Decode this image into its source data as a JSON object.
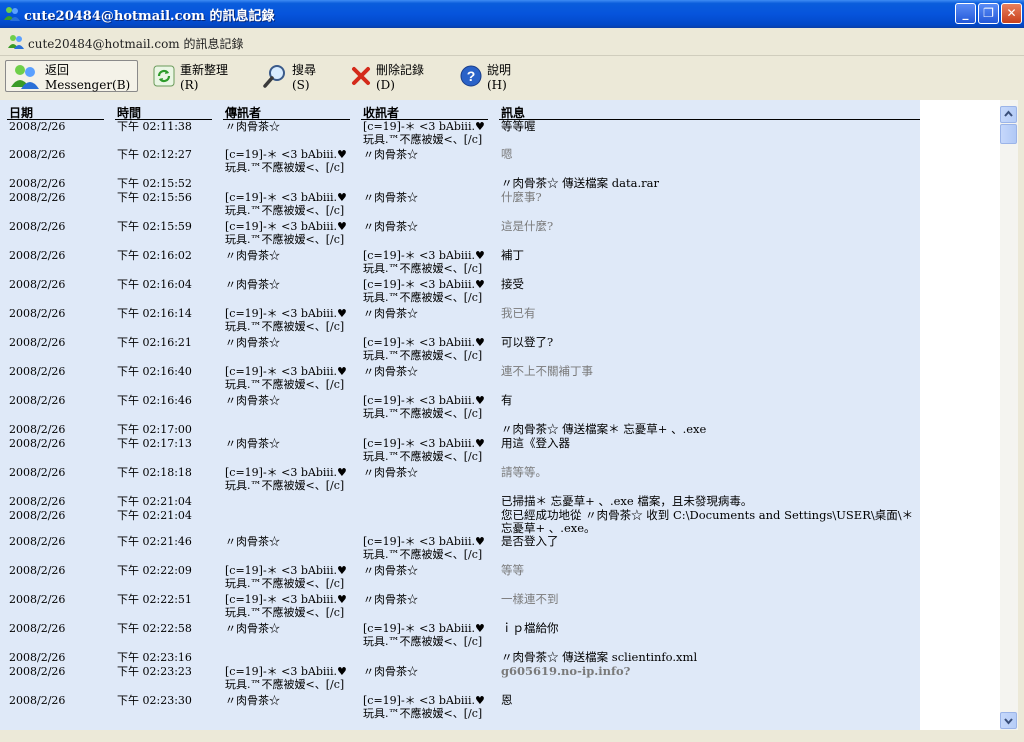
{
  "window": {
    "title": "cute20484@hotmail.com 的訊息記錄",
    "minimize": "_",
    "maximize": "❐",
    "close": "✕"
  },
  "header": {
    "title": "cute20484@hotmail.com 的訊息記錄"
  },
  "toolbar": {
    "back": "返回 Messenger(B)",
    "refresh": "重新整理(R)",
    "search": "搜尋(S)",
    "delete": "刪除記錄(D)",
    "help": "說明(H)"
  },
  "columns": {
    "date": "日期",
    "time": "時間",
    "sender": "傳訊者",
    "receiver": "收訊者",
    "message": "訊息"
  },
  "rows": [
    {
      "date": "2008/2/26",
      "time": "下午 02:11:38",
      "sender": "〃肉骨茶☆",
      "receiver": "[c=19]-＊ <3 bAbiii.♥玩具.™不應被嫒<、[/c]",
      "message": "等等喔",
      "style": "normal"
    },
    {
      "date": "2008/2/26",
      "time": "下午 02:12:27",
      "sender": "[c=19]-＊ <3 bAbiii.♥玩具.™不應被嫒<、[/c]",
      "receiver": "〃肉骨茶☆",
      "message": "嗯",
      "style": "grey"
    },
    {
      "date": "2008/2/26",
      "time": "下午 02:15:52",
      "sender": "",
      "receiver": "",
      "message": "〃肉骨茶☆ 傳送檔案 data.rar",
      "style": "normal"
    },
    {
      "date": "2008/2/26",
      "time": "下午 02:15:56",
      "sender": "[c=19]-＊ <3 bAbiii.♥玩具.™不應被嫒<、[/c]",
      "receiver": "〃肉骨茶☆",
      "message": "什麼事?",
      "style": "grey"
    },
    {
      "date": "2008/2/26",
      "time": "下午 02:15:59",
      "sender": "[c=19]-＊ <3 bAbiii.♥玩具.™不應被嫒<、[/c]",
      "receiver": "〃肉骨茶☆",
      "message": "這是什麼?",
      "style": "grey"
    },
    {
      "date": "2008/2/26",
      "time": "下午 02:16:02",
      "sender": "〃肉骨茶☆",
      "receiver": "[c=19]-＊ <3 bAbiii.♥玩具.™不應被嫒<、[/c]",
      "message": "補丁",
      "style": "normal"
    },
    {
      "date": "2008/2/26",
      "time": "下午 02:16:04",
      "sender": "〃肉骨茶☆",
      "receiver": "[c=19]-＊ <3 bAbiii.♥玩具.™不應被嫒<、[/c]",
      "message": "接受",
      "style": "normal"
    },
    {
      "date": "2008/2/26",
      "time": "下午 02:16:14",
      "sender": "[c=19]-＊ <3 bAbiii.♥玩具.™不應被嫒<、[/c]",
      "receiver": "〃肉骨茶☆",
      "message": "我已有",
      "style": "grey"
    },
    {
      "date": "2008/2/26",
      "time": "下午 02:16:21",
      "sender": "〃肉骨茶☆",
      "receiver": "[c=19]-＊ <3 bAbiii.♥玩具.™不應被嫒<、[/c]",
      "message": "可以登了?",
      "style": "normal"
    },
    {
      "date": "2008/2/26",
      "time": "下午 02:16:40",
      "sender": "[c=19]-＊ <3 bAbiii.♥玩具.™不應被嫒<、[/c]",
      "receiver": "〃肉骨茶☆",
      "message": "連不上不關補丁事",
      "style": "grey"
    },
    {
      "date": "2008/2/26",
      "time": "下午 02:16:46",
      "sender": "〃肉骨茶☆",
      "receiver": "[c=19]-＊ <3 bAbiii.♥玩具.™不應被嫒<、[/c]",
      "message": "有",
      "style": "normal"
    },
    {
      "date": "2008/2/26",
      "time": "下午 02:17:00",
      "sender": "",
      "receiver": "",
      "message": "〃肉骨茶☆ 傳送檔案＊ 忘憂草+ 、.exe",
      "style": "normal"
    },
    {
      "date": "2008/2/26",
      "time": "下午 02:17:13",
      "sender": "〃肉骨茶☆",
      "receiver": "[c=19]-＊ <3 bAbiii.♥玩具.™不應被嫒<、[/c]",
      "message": "用這《登入器",
      "style": "normal"
    },
    {
      "date": "2008/2/26",
      "time": "下午 02:18:18",
      "sender": "[c=19]-＊ <3 bAbiii.♥玩具.™不應被嫒<、[/c]",
      "receiver": "〃肉骨茶☆",
      "message": "請等等。",
      "style": "grey"
    },
    {
      "date": "2008/2/26",
      "time": "下午 02:21:04",
      "sender": "",
      "receiver": "",
      "message": "已掃描＊ 忘憂草+ 、.exe 檔案，且未發現病毒。",
      "style": "normal"
    },
    {
      "date": "2008/2/26",
      "time": "下午 02:21:04",
      "sender": "",
      "receiver": "",
      "message": "您已經成功地從 〃肉骨茶☆ 收到 C:\\Documents and Settings\\USER\\桌面\\＊ 忘憂草+ 、.exe。",
      "style": "normal"
    },
    {
      "date": "2008/2/26",
      "time": "下午 02:21:46",
      "sender": "〃肉骨茶☆",
      "receiver": "[c=19]-＊ <3 bAbiii.♥玩具.™不應被嫒<、[/c]",
      "message": "是否登入了",
      "style": "normal"
    },
    {
      "date": "2008/2/26",
      "time": "下午 02:22:09",
      "sender": "[c=19]-＊ <3 bAbiii.♥玩具.™不應被嫒<、[/c]",
      "receiver": "〃肉骨茶☆",
      "message": "等等",
      "style": "grey"
    },
    {
      "date": "2008/2/26",
      "time": "下午 02:22:51",
      "sender": "[c=19]-＊ <3 bAbiii.♥玩具.™不應被嫒<、[/c]",
      "receiver": "〃肉骨茶☆",
      "message": "一樣連不到",
      "style": "grey"
    },
    {
      "date": "2008/2/26",
      "time": "下午 02:22:58",
      "sender": "〃肉骨茶☆",
      "receiver": "[c=19]-＊ <3 bAbiii.♥玩具.™不應被嫒<、[/c]",
      "message": "ｉｐ檔給你",
      "style": "normal"
    },
    {
      "date": "2008/2/26",
      "time": "下午 02:23:16",
      "sender": "",
      "receiver": "",
      "message": "〃肉骨茶☆ 傳送檔案 sclientinfo.xml",
      "style": "normal"
    },
    {
      "date": "2008/2/26",
      "time": "下午 02:23:23",
      "sender": "[c=19]-＊ <3 bAbiii.♥玩具.™不應被嫒<、[/c]",
      "receiver": "〃肉骨茶☆",
      "message": "g605619.no-ip.info?",
      "style": "greybold"
    },
    {
      "date": "2008/2/26",
      "time": "下午 02:23:30",
      "sender": "〃肉骨茶☆",
      "receiver": "[c=19]-＊ <3 bAbiii.♥玩具.™不應被嫒<、[/c]",
      "message": "恩",
      "style": "normal"
    }
  ],
  "colors": {
    "titlebar": "#0654dc",
    "sheet": "#dfe9f8",
    "chrome": "#ece9d8"
  },
  "icons": {
    "app": "messenger-buddies-icon",
    "back": "messenger-buddies-icon",
    "refresh": "refresh-icon",
    "search": "magnifier-icon",
    "delete": "red-x-icon",
    "help": "help-question-icon"
  }
}
